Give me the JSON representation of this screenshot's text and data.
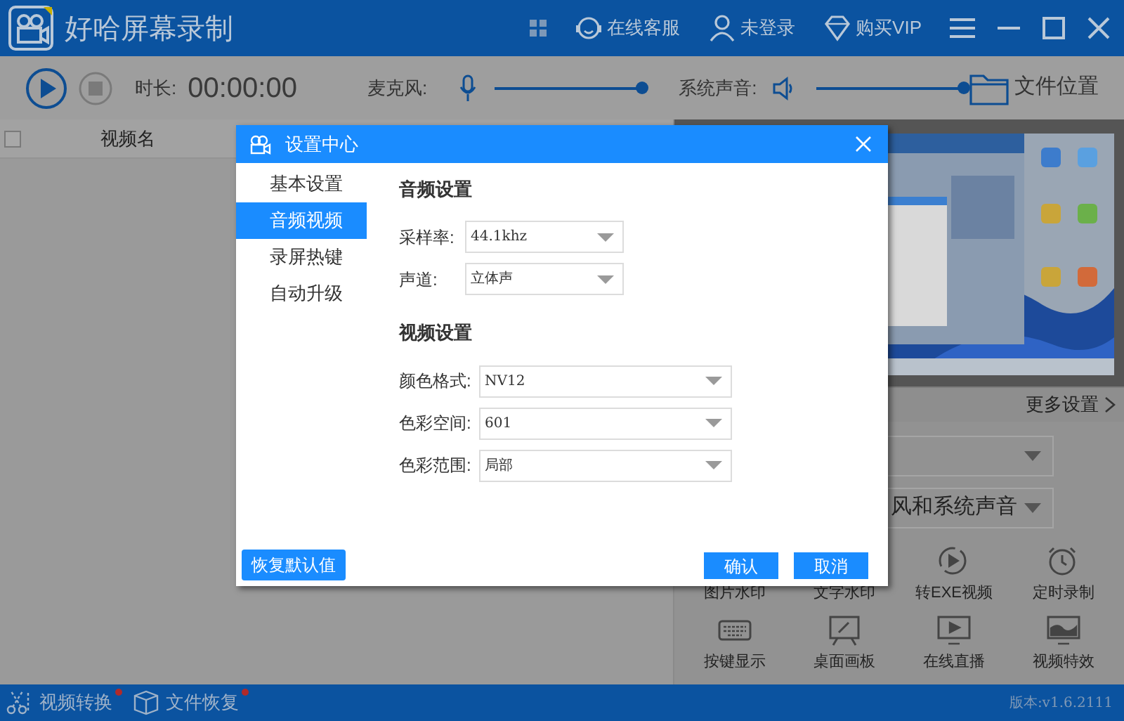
{
  "window": {
    "title": "好哈屏幕录制"
  },
  "header_links": [
    {
      "kind": "service",
      "label": "在线客服"
    },
    {
      "kind": "user",
      "label": "未登录"
    },
    {
      "kind": "vip",
      "label": "购买VIP"
    }
  ],
  "toolbar": {
    "duration_label": "时长:",
    "duration": "00:00:00",
    "mic_label": "麦克风:",
    "mic": {
      "level": 1
    },
    "system_label": "系统声音:",
    "system": {
      "level": 1
    },
    "folder_label": "文件位置"
  },
  "table": {
    "columns": [
      "视频名"
    ],
    "select_all": {
      "checked": false
    }
  },
  "right_panel": {
    "more_settings": "更多设置",
    "dropdowns": [
      {
        "kind": "select"
      },
      {
        "kind": "select",
        "value": "风和系统声音"
      }
    ],
    "tools": [
      {
        "label": "图片水印"
      },
      {
        "kind": "text",
        "label": "文字水印"
      },
      {
        "kind": "exe",
        "label": "转EXE视频"
      },
      {
        "kind": "timer",
        "label": "定时录制"
      },
      {
        "kind": "keyboard",
        "label": "按键显示"
      },
      {
        "kind": "board",
        "label": "桌面画板"
      },
      {
        "kind": "live",
        "label": "在线直播"
      },
      {
        "kind": "effect",
        "label": "视频特效"
      }
    ]
  },
  "dialog": {
    "title": "设置中心",
    "nav": [
      {
        "label": "基本设置",
        "selected": false
      },
      {
        "label": "音频视频",
        "selected": true
      },
      {
        "label": "录屏热键",
        "selected": false
      },
      {
        "label": "自动升级",
        "selected": false
      }
    ],
    "sections": [
      {
        "title": "音频设置",
        "fields": [
          {
            "label": "采样率:",
            "value": "44.1khz"
          },
          {
            "label": "声道:",
            "value": "立体声"
          }
        ]
      },
      {
        "title": "视频设置",
        "fields": [
          {
            "label": "颜色格式:",
            "value": "NV12"
          },
          {
            "label": "色彩空间:",
            "value": "601"
          },
          {
            "label": "色彩范围:",
            "value": "局部"
          }
        ]
      }
    ],
    "reset_button": "恢复默认值",
    "ok_button": "确认",
    "cancel_button": "取消"
  },
  "status_bar": {
    "items": [
      {
        "kind": "convert",
        "label": "视频转换",
        "badge": true
      },
      {
        "kind": "recover",
        "label": "文件恢复",
        "badge": true
      }
    ],
    "version": "版本:v1.6.2111"
  }
}
